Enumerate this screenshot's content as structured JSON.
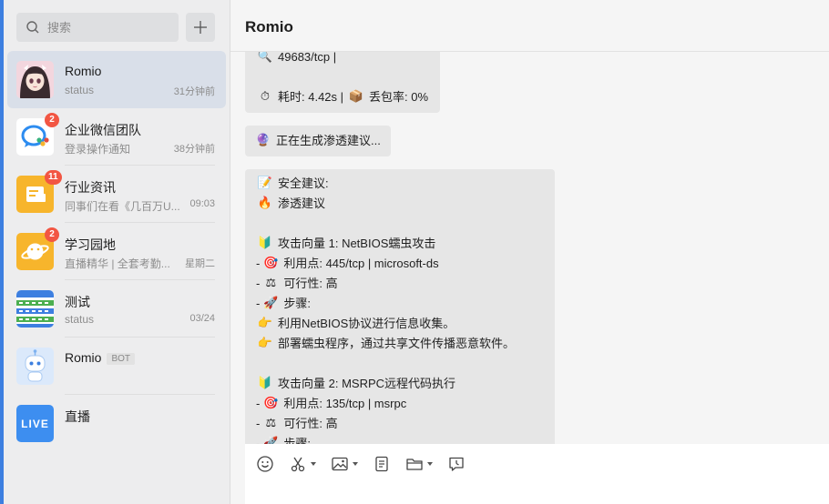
{
  "search": {
    "placeholder": "搜索"
  },
  "colors": {
    "accent": "#3d7fe0",
    "badge": "#f25643",
    "active_row": "#d9dfe9"
  },
  "conversations": [
    {
      "name": "Romio",
      "sub": "status",
      "time": "31分钟前",
      "avatar": "anime-girl-avatar",
      "active": true
    },
    {
      "name": "企业微信团队",
      "sub": "登录操作通知",
      "time": "38分钟前",
      "badge": "2",
      "avatar": "wecom-team-icon"
    },
    {
      "name": "行业资讯",
      "sub": "同事们在看《几百万U...",
      "time": "09:03",
      "badge": "11",
      "avatar": "news-icon"
    },
    {
      "name": "学习园地",
      "sub": "直播精华 | 全套考勤...",
      "time": "星期二",
      "badge": "2",
      "avatar": "planet-icon"
    },
    {
      "name": "测试",
      "sub": "status",
      "time": "03/24",
      "avatar": "keyboard-grid-icon"
    },
    {
      "name": "Romio",
      "tag": "BOT",
      "avatar": "robot-icon"
    },
    {
      "name": "直播",
      "avatar": "live-icon",
      "avatar_text": "LIVE"
    }
  ],
  "chat": {
    "title": "Romio",
    "message1": {
      "port_line": "49683/tcp |",
      "stats_time": "耗时: 4.42s |",
      "stats_loss": "丢包率: 0%"
    },
    "message2": {
      "text": "正在生成渗透建议..."
    },
    "message3": {
      "security_title": "安全建议:",
      "pen_title": "渗透建议",
      "vector1": {
        "title": "攻击向量 1: NetBIOS蠕虫攻击",
        "point": "利用点:  445/tcp | microsoft-ds",
        "feasibility": "可行性:  高",
        "steps_label": "步骤:",
        "step1": "利用NetBIOS协议进行信息收集。",
        "step2": "部署蠕虫程序，通过共享文件传播恶意软件。"
      },
      "vector2": {
        "title": "攻击向量 2: MSRPC远程代码执行",
        "point": "利用点:  135/tcp | msrpc",
        "feasibility": "可行性:  高",
        "steps_label": "步骤:"
      }
    }
  },
  "toolbar": [
    "emoji-icon",
    "screenshot-scissors-icon",
    "image-icon",
    "document-icon",
    "folder-icon",
    "schedule-message-icon"
  ]
}
